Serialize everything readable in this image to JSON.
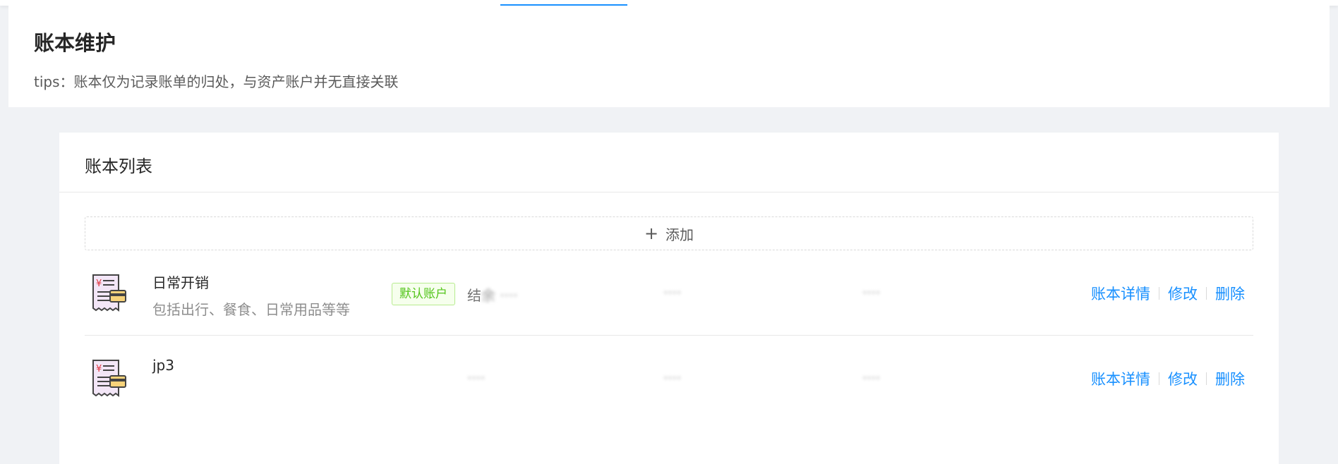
{
  "header": {
    "title": "账本维护",
    "tips": "tips：账本仅为记录账单的归处，与资产账户并无直接关联"
  },
  "card": {
    "title": "账本列表",
    "add_label": "添加"
  },
  "colors": {
    "primary": "#1890ff",
    "tag_green": "#52c41a",
    "background": "#f0f2f5"
  },
  "books": [
    {
      "icon": "receipt-card-icon",
      "name": "日常开销",
      "description": "包括出行、餐食、日常用品等等",
      "default_tag": "默认账户",
      "meta_prefix": "结",
      "meta1": "余 ····",
      "meta2": "····",
      "meta3": "····",
      "actions": {
        "detail": "账本详情",
        "edit": "修改",
        "delete": "删除"
      }
    },
    {
      "icon": "receipt-card-icon",
      "name": "jp3",
      "description": "",
      "default_tag": "",
      "meta_prefix": "",
      "meta1": "····",
      "meta2": "····",
      "meta3": "····",
      "actions": {
        "detail": "账本详情",
        "edit": "修改",
        "delete": "删除"
      }
    }
  ]
}
